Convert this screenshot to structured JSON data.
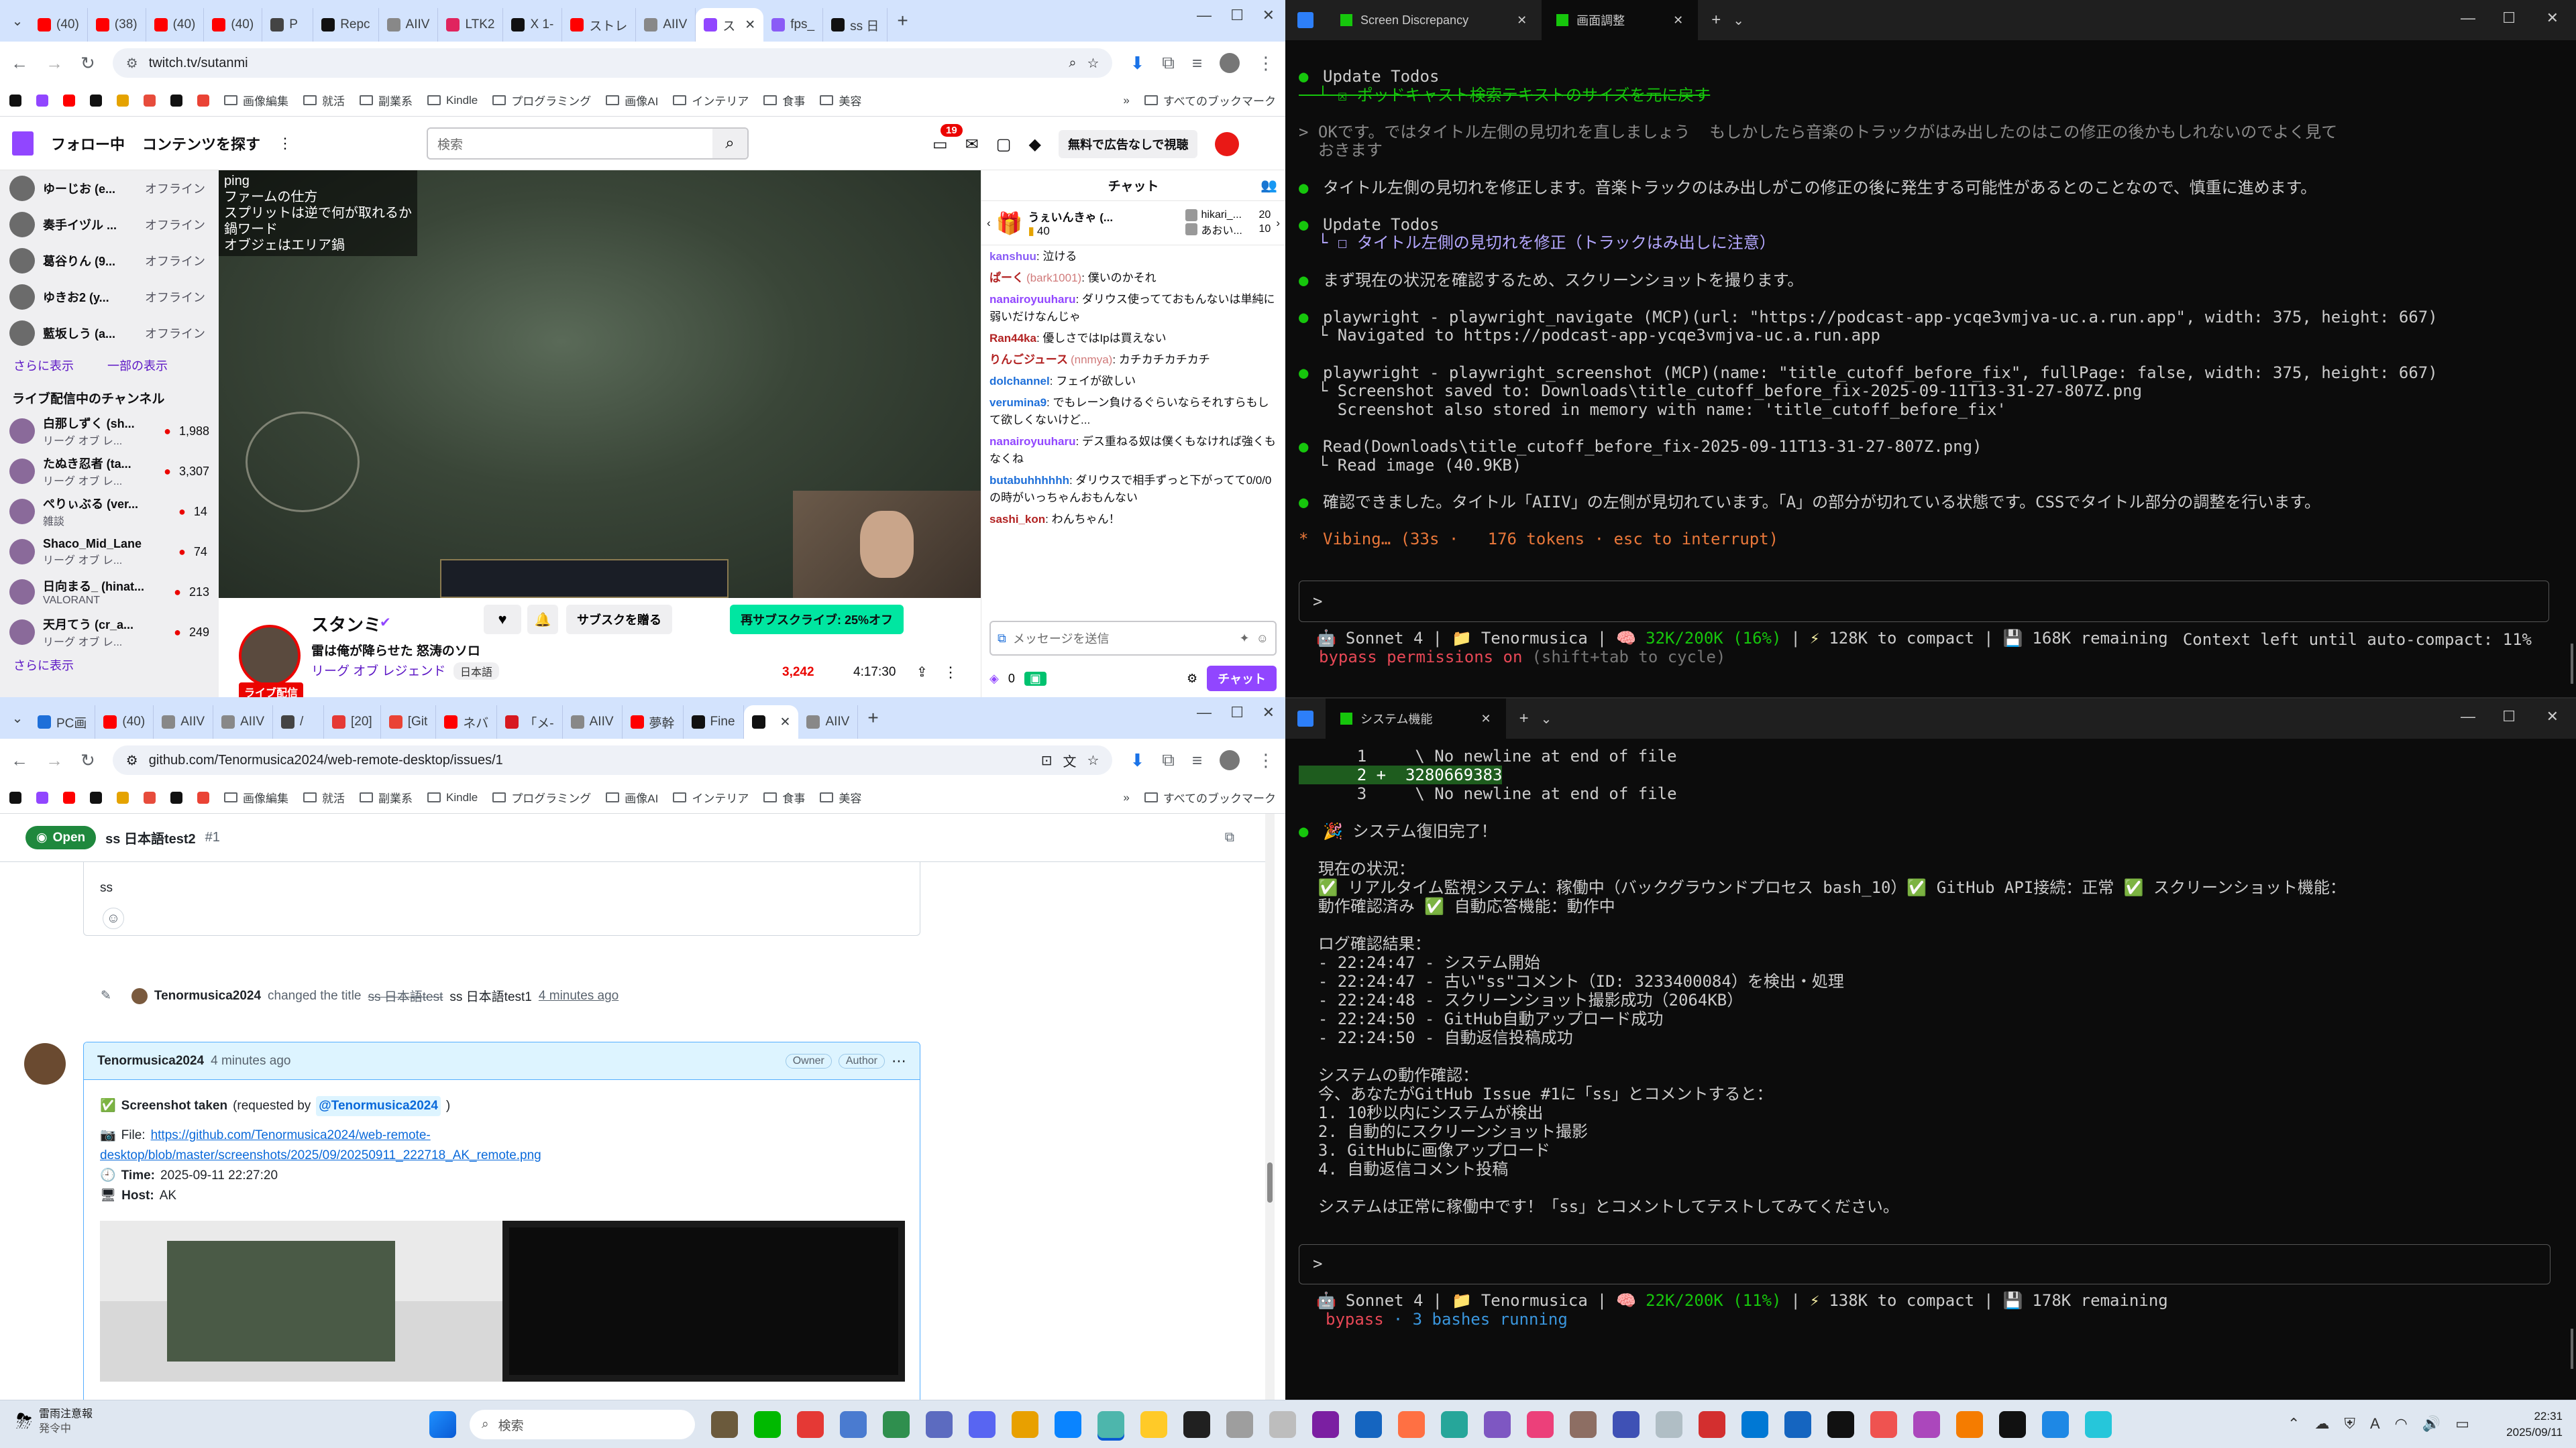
{
  "browser_top": {
    "tabs": [
      {
        "label": "(40)",
        "color": "#ff0000"
      },
      {
        "label": "(38)",
        "color": "#ff0000"
      },
      {
        "label": "(40)",
        "color": "#ff0000"
      },
      {
        "label": "(40)",
        "color": "#ff0000"
      },
      {
        "label": "P",
        "color": "#444"
      },
      {
        "label": "Repc",
        "color": "#111"
      },
      {
        "label": "AIIV",
        "color": "#888"
      },
      {
        "label": "LTK2",
        "color": "#e0245e"
      },
      {
        "label": "X 1-",
        "color": "#111"
      },
      {
        "label": "ストレ",
        "color": "#ff0000"
      },
      {
        "label": "AIIV",
        "color": "#888"
      },
      {
        "label": "ス",
        "color": "#9146ff",
        "active": true
      },
      {
        "label": "fps_",
        "color": "#8a5cf6"
      },
      {
        "label": "ss 日",
        "color": "#111"
      }
    ],
    "url": "twitch.tv/sutanmi",
    "bookmarks": [
      "画像編集",
      "就活",
      "副業系",
      "Kindle",
      "プログラミング",
      "画像AI",
      "インテリア",
      "食事",
      "美容"
    ],
    "all_bookmarks": "すべてのブックマーク"
  },
  "twitch": {
    "nav_following": "フォロー中",
    "nav_browse": "コンテンツを探す",
    "search_placeholder": "検索",
    "notif_count": "19",
    "ad_free": "無料で広告なしで視聴",
    "sidebar_top": [
      {
        "name": "ゆーじお (e...",
        "status": "オフライン"
      },
      {
        "name": "奏手イヅル ...",
        "status": "オフライン"
      },
      {
        "name": "葛谷りん (9...",
        "status": "オフライン"
      },
      {
        "name": "ゆきお2 (y...",
        "status": "オフライン"
      },
      {
        "name": "藍坂しう (a...",
        "status": "オフライン"
      }
    ],
    "show_more": "さらに表示",
    "show_some": "一部の表示",
    "live_header": "ライブ配信中のチャンネル",
    "live": [
      {
        "name": "白那しずく (sh...",
        "game": "リーグ オブ レ...",
        "viewers": "1,988"
      },
      {
        "name": "たぬき忍者 (ta...",
        "game": "リーグ オブ レ...",
        "viewers": "3,307"
      },
      {
        "name": "ぺりぃぶる (ver...",
        "game": "雑談",
        "viewers": "14"
      },
      {
        "name": "Shaco_Mid_Lane",
        "game": "リーグ オブ レ...",
        "viewers": "74"
      },
      {
        "name": "日向まる_ (hinat...",
        "game": "VALORANT",
        "viewers": "213"
      },
      {
        "name": "天月てう (cr_a...",
        "game": "リーグ オブ レ...",
        "viewers": "249"
      }
    ],
    "show_more2": "さらに表示",
    "video_overlay": [
      "ping",
      "ファームの仕方",
      "スプリットは逆で何が取れるか",
      "鍋ワード",
      "オブジェはエリア鍋"
    ],
    "streamer": "スタンミ",
    "stream_title": "雷は俺が降らせた 怒涛のソロ",
    "game": "リーグ オブ レジェンド",
    "lang": "日本語",
    "live_badge": "ライブ配信",
    "sub_button": "サブスクを贈る",
    "hype": "再サブスクライブ: 25%オフ",
    "viewers": "3,242",
    "uptime": "4:17:30",
    "chat_title": "チャット",
    "gift": {
      "name": "うぇいんきゃ (...",
      "count": "40"
    },
    "leaders": [
      {
        "name": "hikari_...",
        "count": "20"
      },
      {
        "name": "あおい...",
        "count": "10"
      }
    ],
    "chat": [
      {
        "user": "kanshuu",
        "color": "#8a5cf6",
        "msg": "泣ける"
      },
      {
        "user": "ぱーく",
        "note": "(bark1001)",
        "color": "#b22222",
        "msg": "僕いのかそれ"
      },
      {
        "user": "nanairoyuuharu",
        "color": "#9146ff",
        "msg": "ダリウス使ってておもんないは単純に弱いだけなんじゃ"
      },
      {
        "user": "Ran44ka",
        "color": "#b22222",
        "msg": "優しさではIpは買えない"
      },
      {
        "user": "りんごジュース",
        "note": "(nnmya)",
        "color": "#b22222",
        "msg": "カチカチカチカチ"
      },
      {
        "user": "dolchannel",
        "color": "#1e6fd9",
        "msg": "フェイが欲しい"
      },
      {
        "user": "verumina9",
        "color": "#1e6fd9",
        "msg": "でもレーン負けるぐらいならそれすらもして欲しくないけど..."
      },
      {
        "user": "nanairoyuuharu",
        "color": "#9146ff",
        "msg": "デス重ねる奴は僕くもなければ強くもなくね"
      },
      {
        "user": "butabuhhhhhh",
        "color": "#1e6fd9",
        "msg": "ダリウスで相手ずっと下がってて0/0/0の時がいっちゃんおもんない"
      },
      {
        "user": "sashi_kon",
        "color": "#b22222",
        "msg": "わんちゃん！"
      }
    ],
    "chat_placeholder": "メッセージを送信",
    "points": "0",
    "chat_button": "チャット"
  },
  "browser_bottom": {
    "tabs": [
      {
        "label": "PC画",
        "color": "#1e6fd9"
      },
      {
        "label": "(40)",
        "color": "#ff0000"
      },
      {
        "label": "AIIV",
        "color": "#888"
      },
      {
        "label": "AIIV",
        "color": "#888"
      },
      {
        "label": "/",
        "color": "#444"
      },
      {
        "label": "[20]",
        "color": "#e53935"
      },
      {
        "label": "[Git",
        "color": "#ea4335"
      },
      {
        "label": "ネバ",
        "color": "#ff0000"
      },
      {
        "label": "「メ-",
        "color": "#d71920"
      },
      {
        "label": "AIIV",
        "color": "#888"
      },
      {
        "label": "夢幹",
        "color": "#ff0000"
      },
      {
        "label": "Fine",
        "color": "#111"
      },
      {
        "label": "",
        "color": "#111",
        "active": true
      },
      {
        "label": "AIIV",
        "color": "#888"
      }
    ],
    "url": "github.com/Tenormusica2024/web-remote-desktop/issues/1",
    "bookmarks": [
      "画像編集",
      "就活",
      "副業系",
      "Kindle",
      "プログラミング",
      "画像AI",
      "インテリア",
      "食事",
      "美容"
    ],
    "all_bookmarks": "すべてのブックマーク"
  },
  "github": {
    "state": "Open",
    "title": "ss 日本語test2",
    "number": "#1",
    "comment_body": "ss",
    "event_user": "Tenormusica2024",
    "event_text": "changed the title",
    "old_title": "ss 日本語test",
    "new_title": "ss 日本語test1",
    "event_time": "4 minutes ago",
    "comment_user": "Tenormusica2024",
    "comment_time": "4 minutes ago",
    "owner": "Owner",
    "author": "Author",
    "shot_taken": "Screenshot taken",
    "requested_by_prefix": "(requested by",
    "requested_by": "@Tenormusica2024",
    "file_label": "File:",
    "file_link1": "https://github.com/Tenormusica2024/web-remote-",
    "file_link2": "desktop/blob/master/screenshots/2025/09/20250911_222718_AK_remote.png",
    "time_label": "Time:",
    "time_value": "2025-09-11 22:27:20",
    "host_label": "Host:",
    "host_value": "AK"
  },
  "terminal_top": {
    "tabs": [
      "Screen Discrepancy",
      "画面調整"
    ],
    "lines": [
      {
        "b": "●",
        "t": "Update Todos"
      },
      {
        "t": "  └ ☒ ポッドキャスト検索テキストのサイズを元に戻す",
        "strike": true
      },
      {
        "t": ""
      },
      {
        "t": "> OKです。ではタイトル左側の見切れを直しましょう  もしかしたら音楽のトラックがはみ出したのはこの修正の後かもしれないのでよく見て",
        "dim": true
      },
      {
        "t": "  おきます",
        "dim": true
      },
      {
        "t": ""
      },
      {
        "b": "●",
        "t": "タイトル左側の見切れを修正します。音楽トラックのはみ出しがこの修正の後に発生する可能性があるとのことなので、慎重に進めます。"
      },
      {
        "t": ""
      },
      {
        "b": "●",
        "t": "Update Todos"
      },
      {
        "t": "  └ ☐ タイトル左側の見切れを修正（トラックはみ出しに注意）",
        "purple": true
      },
      {
        "t": ""
      },
      {
        "b": "●",
        "t": "まず現在の状況を確認するため、スクリーンショットを撮ります。"
      },
      {
        "t": ""
      },
      {
        "b": "●",
        "t": "playwright - playwright_navigate (MCP)(url: \"https://podcast-app-ycqe3vmjva-uc.a.run.app\", width: 375, height: 667)"
      },
      {
        "t": "  └ Navigated to https://podcast-app-ycqe3vmjva-uc.a.run.app"
      },
      {
        "t": ""
      },
      {
        "b": "●",
        "t": "playwright - playwright_screenshot (MCP)(name: \"title_cutoff_before_fix\", fullPage: false, width: 375, height: 667)"
      },
      {
        "t": "  └ Screenshot saved to: Downloads\\title_cutoff_before_fix-2025-09-11T13-31-27-807Z.png"
      },
      {
        "t": "    Screenshot also stored in memory with name: 'title_cutoff_before_fix'"
      },
      {
        "t": ""
      },
      {
        "b": "●",
        "t": "Read(Downloads\\title_cutoff_before_fix-2025-09-11T13-31-27-807Z.png)"
      },
      {
        "t": "  └ Read image (40.9KB)"
      },
      {
        "t": ""
      },
      {
        "b": "●",
        "t": "確認できました。タイトル「AIIV」の左側が見切れています。「A」の部分が切れている状態です。CSSでタイトル部分の調整を行います。"
      },
      {
        "t": ""
      },
      {
        "b": "*",
        "t": "Vibing… (33s ·   176 tokens · esc to interrupt)",
        "vibe": true
      }
    ],
    "status": {
      "model": "Sonnet 4",
      "dir": "Tenormusica",
      "ctx": "32K/200K (16%)",
      "compact": "128K to compact",
      "remaining": "168K remaining",
      "auto": "Context left until auto-compact: 11%"
    },
    "bypass": "bypass permissions on",
    "bypass_hint": "(shift+tab to cycle)"
  },
  "terminal_bottom": {
    "tabs": [
      "システム機能"
    ],
    "lines": [
      {
        "t": "      1     \\ No newline at end of file"
      },
      {
        "t": "      2 +  3280669383",
        "added": true
      },
      {
        "t": "      3     \\ No newline at end of file"
      },
      {
        "t": ""
      },
      {
        "b": "●",
        "t": "🎉 システム復旧完了！"
      },
      {
        "t": ""
      },
      {
        "t": "  現在の状況："
      },
      {
        "t": "  ✅ リアルタイム監視システム：稼働中（バックグラウンドプロセス bash_10）✅ GitHub API接続：正常 ✅ スクリーンショット機能："
      },
      {
        "t": "  動作確認済み ✅ 自動応答機能：動作中"
      },
      {
        "t": ""
      },
      {
        "t": "  ログ確認結果："
      },
      {
        "t": "  - 22:24:47 - システム開始"
      },
      {
        "t": "  - 22:24:47 - 古い\"ss\"コメント（ID: 3233400084）を検出・処理"
      },
      {
        "t": "  - 22:24:48 - スクリーンショット撮影成功（2064KB）"
      },
      {
        "t": "  - 22:24:50 - GitHub自動アップロード成功"
      },
      {
        "t": "  - 22:24:50 - 自動返信投稿成功"
      },
      {
        "t": ""
      },
      {
        "t": "  システムの動作確認："
      },
      {
        "t": "  今、あなたがGitHub Issue #1に「ss」とコメントすると："
      },
      {
        "t": "  1. 10秒以内にシステムが検出"
      },
      {
        "t": "  2. 自動的にスクリーンショット撮影"
      },
      {
        "t": "  3. GitHubに画像アップロード"
      },
      {
        "t": "  4. 自動返信コメント投稿"
      },
      {
        "t": ""
      },
      {
        "t": "  システムは正常に稼働中です！「ss」とコメントしてテストしてみてください。"
      }
    ],
    "status": {
      "model": "Sonnet 4",
      "dir": "Tenormusica",
      "ctx": "22K/200K (11%)",
      "compact": "138K to compact",
      "remaining": "178K remaining"
    },
    "bypass": "bypass",
    "bashes": "· 3 bashes running"
  },
  "taskbar": {
    "weather_title": "雷雨注意報",
    "weather_sub": "発令中",
    "search": "検索",
    "time": "22:31",
    "date": "2025/09/11"
  }
}
